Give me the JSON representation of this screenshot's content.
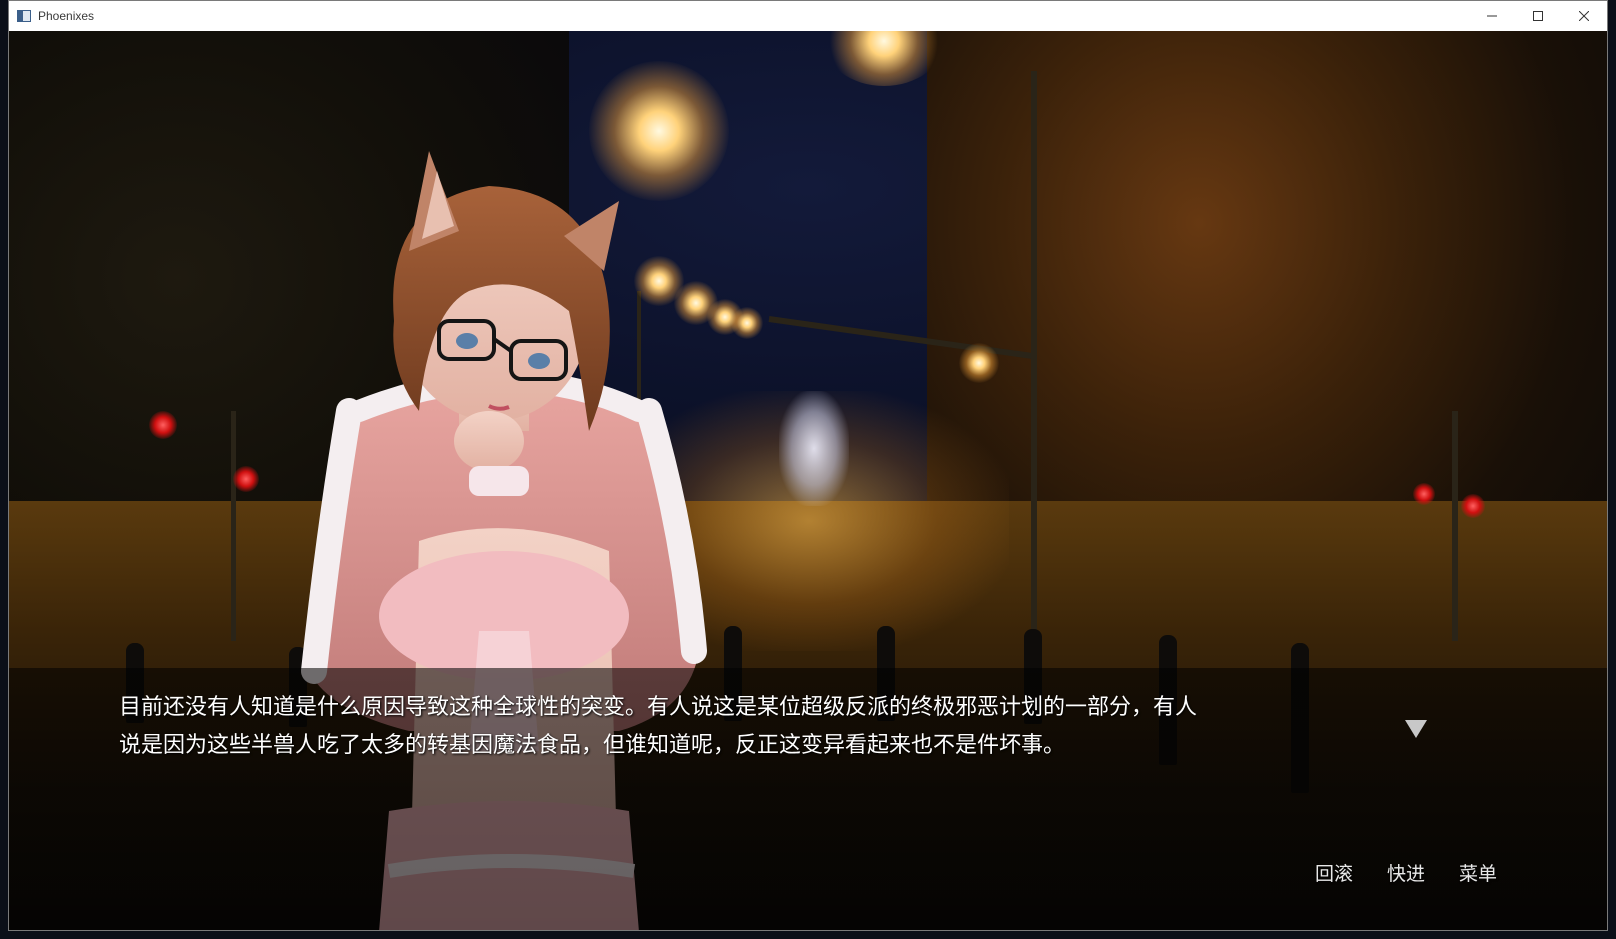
{
  "window": {
    "title": "Phoenixes",
    "controls": {
      "minimize_icon": "minimize-icon",
      "maximize_icon": "maximize-icon",
      "close_icon": "close-icon"
    }
  },
  "dialogue": {
    "text_line1": "目前还没有人知道是什么原因导致这种全球性的突变。有人说这是某位超级反派的终极邪恶计划的一部分，有人",
    "text_line2": "说是因为这些半兽人吃了太多的转基因魔法食品，但谁知道呢，反正这变异看起来也不是件坏事。",
    "continue_icon": "triangle-down-icon"
  },
  "quick_menu": {
    "rollback_label": "回滚",
    "skip_label": "快进",
    "menu_label": "菜单"
  },
  "colors": {
    "text": "#ffffff",
    "dialogue_bg": "rgba(0,0,0,0.55)",
    "menu_text": "#e8e8e8"
  }
}
